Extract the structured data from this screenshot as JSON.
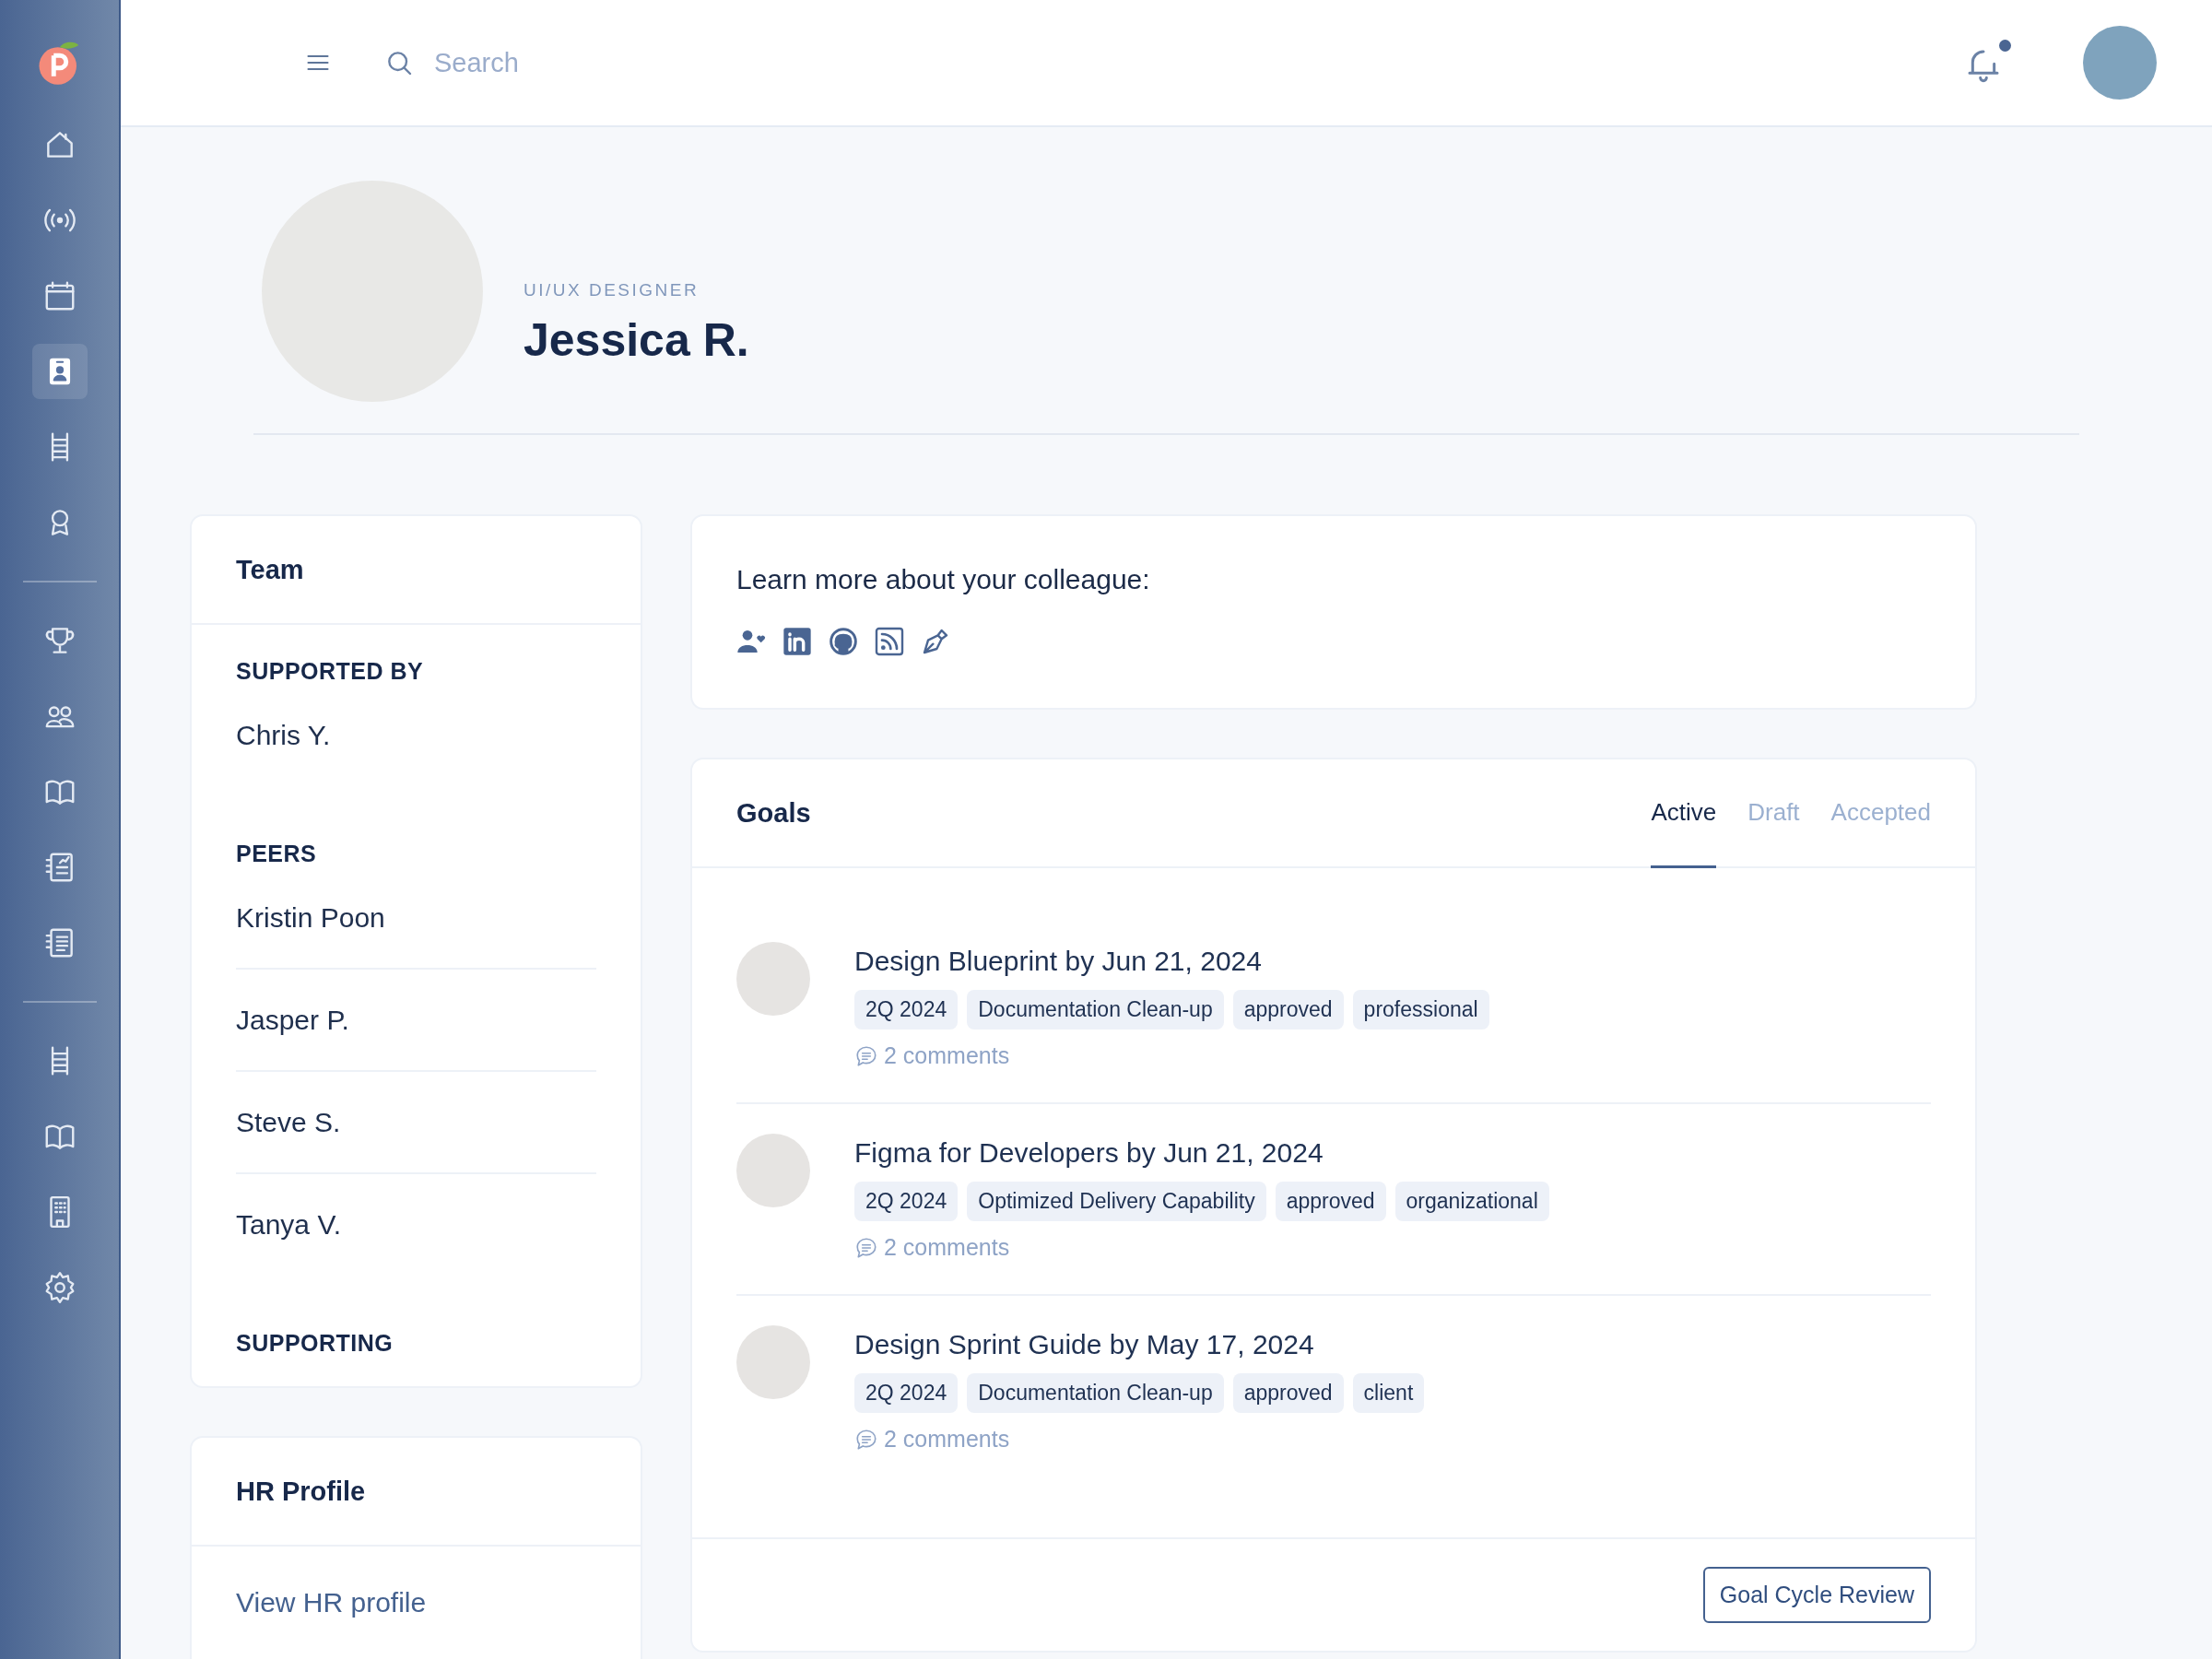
{
  "topbar": {
    "search": {
      "placeholder": "Search"
    },
    "notifications": {
      "unread": true
    }
  },
  "sidebar": {
    "groups": [
      [
        {
          "selected": false
        },
        {
          "selected": false
        },
        {
          "selected": false
        },
        {
          "selected": true
        },
        {
          "selected": false
        },
        {
          "selected": false
        }
      ],
      [
        {
          "selected": false
        },
        {
          "selected": false
        },
        {
          "selected": false
        },
        {
          "selected": false
        },
        {
          "selected": false
        }
      ],
      [
        {
          "selected": false
        },
        {
          "selected": false
        },
        {
          "selected": false
        },
        {
          "selected": false
        }
      ]
    ]
  },
  "profile": {
    "role": "UI/UX DESIGNER",
    "name": "Jessica R."
  },
  "team": {
    "title": "Team",
    "sections": [
      {
        "heading": "SUPPORTED BY",
        "people": [
          "Chris Y."
        ]
      },
      {
        "heading": "PEERS",
        "people": [
          "Kristin Poon",
          "Jasper P.",
          "Steve S.",
          "Tanya V."
        ]
      },
      {
        "heading": "SUPPORTING"
      }
    ]
  },
  "hr_profile": {
    "title": "HR Profile",
    "link": "View HR profile"
  },
  "colleague": {
    "prompt": "Learn more about your colleague:"
  },
  "goals": {
    "title": "Goals",
    "tabs": [
      {
        "label": "Active",
        "selected": true
      },
      {
        "label": "Draft",
        "selected": false
      },
      {
        "label": "Accepted",
        "selected": false
      }
    ],
    "items": [
      {
        "title": "Design Blueprint by Jun 21, 2024",
        "tags": [
          "2Q 2024",
          "Documentation Clean-up",
          "approved",
          "professional"
        ],
        "comments": "2 comments"
      },
      {
        "title": "Figma for Developers by Jun 21, 2024",
        "tags": [
          "2Q 2024",
          "Optimized Delivery Capability",
          "approved",
          "organizational"
        ],
        "comments": "2 comments"
      },
      {
        "title": "Design Sprint Guide by May 17, 2024",
        "tags": [
          "2Q 2024",
          "Documentation Clean-up",
          "approved",
          "client"
        ],
        "comments": "2 comments"
      }
    ],
    "button": "Goal Cycle Review"
  }
}
